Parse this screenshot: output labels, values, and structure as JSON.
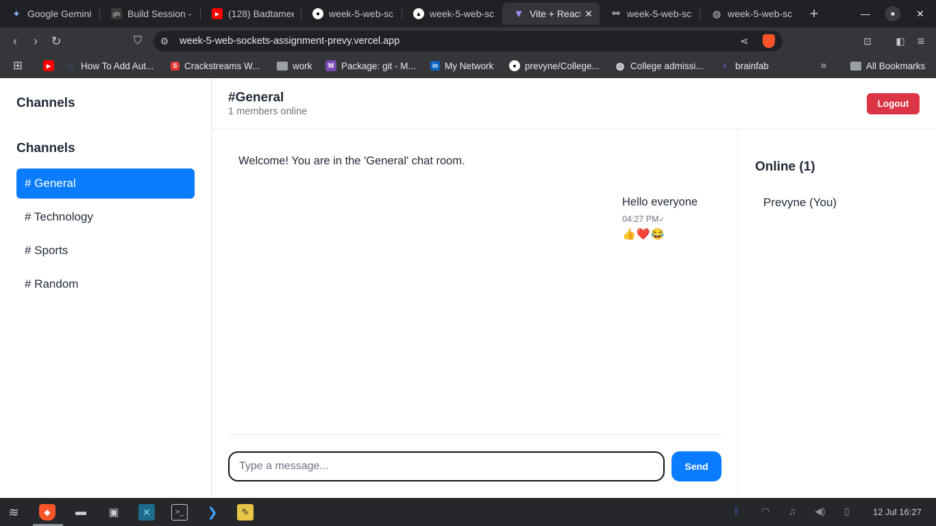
{
  "browser": {
    "tabs": [
      {
        "title": "Google Gemini",
        "icon": "gemini-icon",
        "color": "#8ab4f8"
      },
      {
        "title": "Build Session - ",
        "icon": "gmx-icon",
        "color": "#555"
      },
      {
        "title": "(128) Badtamee",
        "icon": "youtube-icon",
        "color": "#ff0000"
      },
      {
        "title": "week-5-web-sc",
        "icon": "github-icon",
        "color": "#fff"
      },
      {
        "title": "week-5-web-sc",
        "icon": "vercel-icon",
        "color": "#fff"
      },
      {
        "title": "Vite + React",
        "icon": "vite-icon",
        "color": "#a78bfa",
        "active": true
      },
      {
        "title": "week-5-web-sc",
        "icon": "render-icon",
        "color": "#fff"
      },
      {
        "title": "week-5-web-sc",
        "icon": "globe-icon",
        "color": "#c5c7cb"
      }
    ],
    "url": "week-5-web-sockets-assignment-prevy.vercel.app",
    "bookmarks": [
      {
        "label": "",
        "icon": "youtube-icon"
      },
      {
        "label": "How To Add Aut...",
        "icon": "blue-logo-icon"
      },
      {
        "label": "Crackstreams W...",
        "icon": "s-logo-icon"
      },
      {
        "label": "work",
        "icon": "folder-icon"
      },
      {
        "label": "Package: git - M...",
        "icon": "m-logo-icon"
      },
      {
        "label": "My Network",
        "icon": "linkedin-icon"
      },
      {
        "label": "prevyne/College...",
        "icon": "github-icon"
      },
      {
        "label": "College admissi...",
        "icon": "globe-icon"
      },
      {
        "label": "brainfab",
        "icon": "brainfab-icon"
      }
    ],
    "all_bookmarks": "All Bookmarks"
  },
  "sidebar": {
    "title": "Channels",
    "section_title": "Channels",
    "channels": [
      "# General",
      "# Technology",
      "# Sports",
      "# Random"
    ]
  },
  "header": {
    "room": "#General",
    "members": "1 members online",
    "logout": "Logout"
  },
  "chat": {
    "welcome": "Welcome! You are in the 'General' chat room.",
    "message": {
      "text": "Hello everyone",
      "time": "04:27 PM",
      "read_mark": "✓",
      "reactions": "👍❤️😂"
    },
    "input_placeholder": "Type a message...",
    "send": "Send"
  },
  "online": {
    "title": "Online (1)",
    "users": [
      "Prevyne (You)"
    ]
  },
  "taskbar": {
    "clock": "12 Jul 16:27"
  },
  "colors": {
    "accent": "#0a7cff",
    "danger": "#dc3545"
  }
}
